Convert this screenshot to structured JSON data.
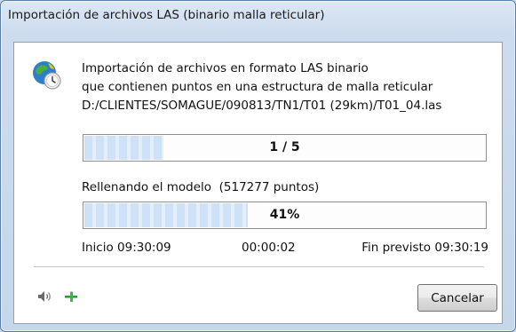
{
  "window": {
    "title": "Importación de archivos LAS (binario malla reticular)"
  },
  "description": {
    "line1": "Importación de archivos en formato LAS binario",
    "line2": "que contienen puntos en una estructura de malla reticular"
  },
  "file_path": "D:/CLIENTES/SOMAGUE/090813/TN1/T01 (29km)/T01_04.las",
  "file_progress": {
    "label": "1 / 5",
    "current": 1,
    "total": 5
  },
  "status": {
    "text": "Rellenando el modelo",
    "count": "(517277 puntos)"
  },
  "overall_progress": {
    "label": "41%",
    "value": 41
  },
  "times": {
    "start": "Inicio 09:30:09",
    "elapsed": "00:00:02",
    "end": "Fin previsto 09:30:19"
  },
  "icons": {
    "app": "globe-clock-icon",
    "sound": "speaker-icon",
    "pin": "pin-icon"
  },
  "buttons": {
    "cancel": "Cancelar"
  }
}
